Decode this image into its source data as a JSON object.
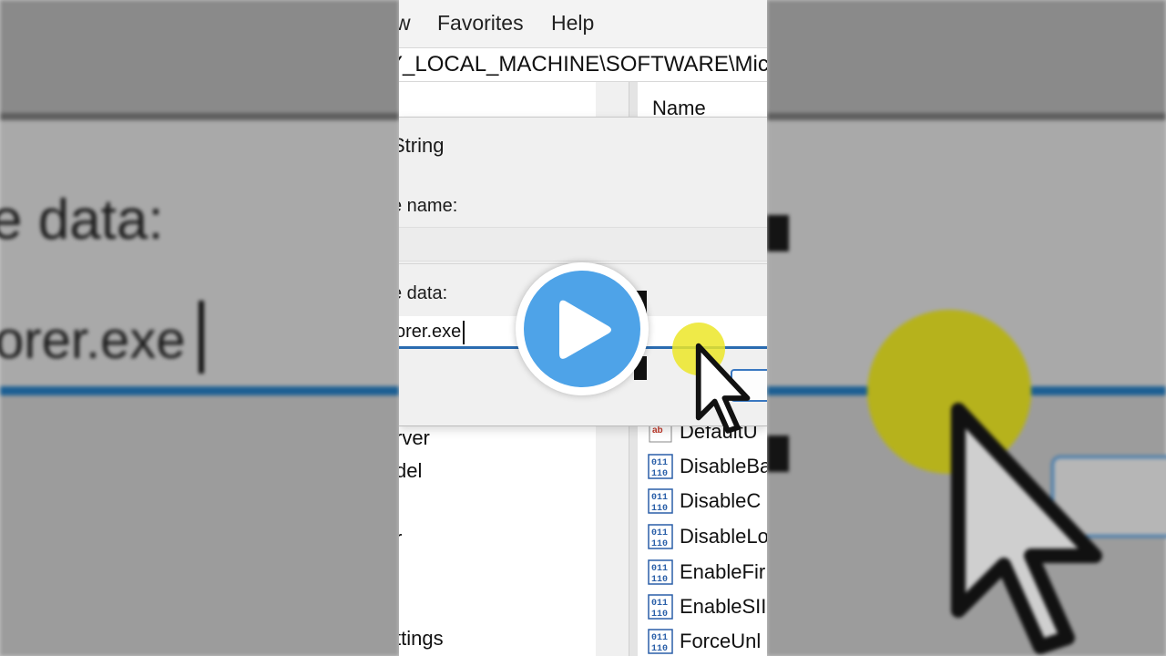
{
  "menu": {
    "view_partial": "w",
    "favorites": "Favorites",
    "help": "Help"
  },
  "address": {
    "path": "Y_LOCAL_MACHINE\\SOFTWARE\\Micro"
  },
  "tree": {
    "items": [
      "rver",
      "del",
      "r",
      "ttings"
    ]
  },
  "list": {
    "header_name": "Name",
    "rows": [
      {
        "name": "DefaultU",
        "icon": "string-value-icon"
      },
      {
        "name": "DisableBa",
        "icon": "binary-value-icon"
      },
      {
        "name": "DisableC",
        "icon": "binary-value-icon"
      },
      {
        "name": "DisableLo",
        "icon": "binary-value-icon"
      },
      {
        "name": "EnableFir",
        "icon": "binary-value-icon"
      },
      {
        "name": "EnableSII",
        "icon": "binary-value-icon"
      },
      {
        "name": "ForceUnl",
        "icon": "binary-value-icon"
      }
    ]
  },
  "dialog": {
    "title": "String",
    "value_name_label": "e name:",
    "value_data_label": "e data:",
    "value_data": "orer.exe"
  },
  "background": {
    "big_label": "e data:",
    "big_value": "orer.exe"
  },
  "colors": {
    "accent": "#2b6cb0",
    "play_button": "#4ea3e8",
    "cursor_highlight": "#ece628"
  }
}
